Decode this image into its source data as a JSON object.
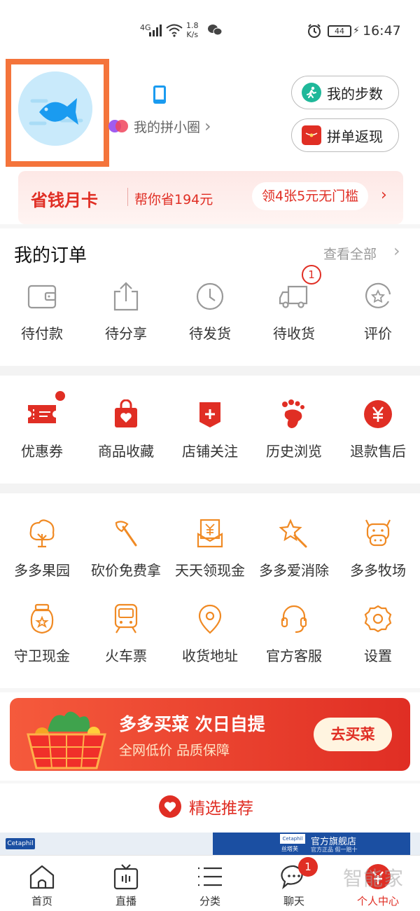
{
  "status_bar": {
    "network": "4G",
    "speed_value": "1.8",
    "speed_unit": "K/s",
    "battery": "44",
    "time": "16:47"
  },
  "profile": {
    "circle_label": "我的拼小圈",
    "circle_arrow": "›",
    "steps_label": "我的步数",
    "cashback_label": "拼单返现"
  },
  "saving_card": {
    "title": "省钱月卡",
    "subtitle": "帮你省194元",
    "coupon": "领4张5元无门槛",
    "arrow": "›"
  },
  "orders": {
    "title": "我的订单",
    "view_all": "查看全部",
    "view_all_arrow": "›",
    "items": [
      {
        "label": "待付款",
        "icon": "wallet-icon"
      },
      {
        "label": "待分享",
        "icon": "share-icon"
      },
      {
        "label": "待发货",
        "icon": "clock-icon"
      },
      {
        "label": "待收货",
        "icon": "truck-icon",
        "badge": "1"
      },
      {
        "label": "评价",
        "icon": "review-icon"
      }
    ]
  },
  "services": {
    "items": [
      {
        "label": "优惠券",
        "icon": "coupon-icon",
        "dot": true
      },
      {
        "label": "商品收藏",
        "icon": "favorite-bag-icon"
      },
      {
        "label": "店铺关注",
        "icon": "store-follow-icon"
      },
      {
        "label": "历史浏览",
        "icon": "footprint-icon"
      },
      {
        "label": "退款售后",
        "icon": "refund-icon"
      }
    ]
  },
  "features": {
    "row1": [
      {
        "label": "多多果园",
        "icon": "tree-icon"
      },
      {
        "label": "砍价免费拿",
        "icon": "axe-icon"
      },
      {
        "label": "天天领现金",
        "icon": "cash-envelope-icon"
      },
      {
        "label": "多多爱消除",
        "icon": "star-wand-icon"
      },
      {
        "label": "多多牧场",
        "icon": "cow-icon"
      }
    ],
    "row2": [
      {
        "label": "守卫现金",
        "icon": "jar-icon"
      },
      {
        "label": "火车票",
        "icon": "train-icon"
      },
      {
        "label": "收货地址",
        "icon": "location-icon"
      },
      {
        "label": "官方客服",
        "icon": "headset-icon"
      },
      {
        "label": "设置",
        "icon": "gear-icon"
      }
    ]
  },
  "banner": {
    "title": "多多买菜 次日自提",
    "subtitle": "全网低价 品质保障",
    "button": "去买菜"
  },
  "recommend": {
    "title": "精选推荐"
  },
  "product_strip": {
    "brand": "Cetaphil",
    "brand_cn": "丝塔芙",
    "store": "官方旗舰店",
    "store_sub": "官方正品 假一赔十"
  },
  "tab_bar": {
    "tabs": [
      {
        "label": "首页",
        "icon": "home-icon"
      },
      {
        "label": "直播",
        "icon": "tv-icon"
      },
      {
        "label": "分类",
        "icon": "list-icon"
      },
      {
        "label": "聊天",
        "icon": "chat-icon",
        "badge": "1"
      },
      {
        "label": "个人中心",
        "icon": "profile-icon",
        "active": true
      }
    ]
  },
  "watermark": "智能家",
  "colors": {
    "brand_red": "#e02e24",
    "accent_orange": "#f08a24",
    "highlight_frame": "#f4743b"
  }
}
